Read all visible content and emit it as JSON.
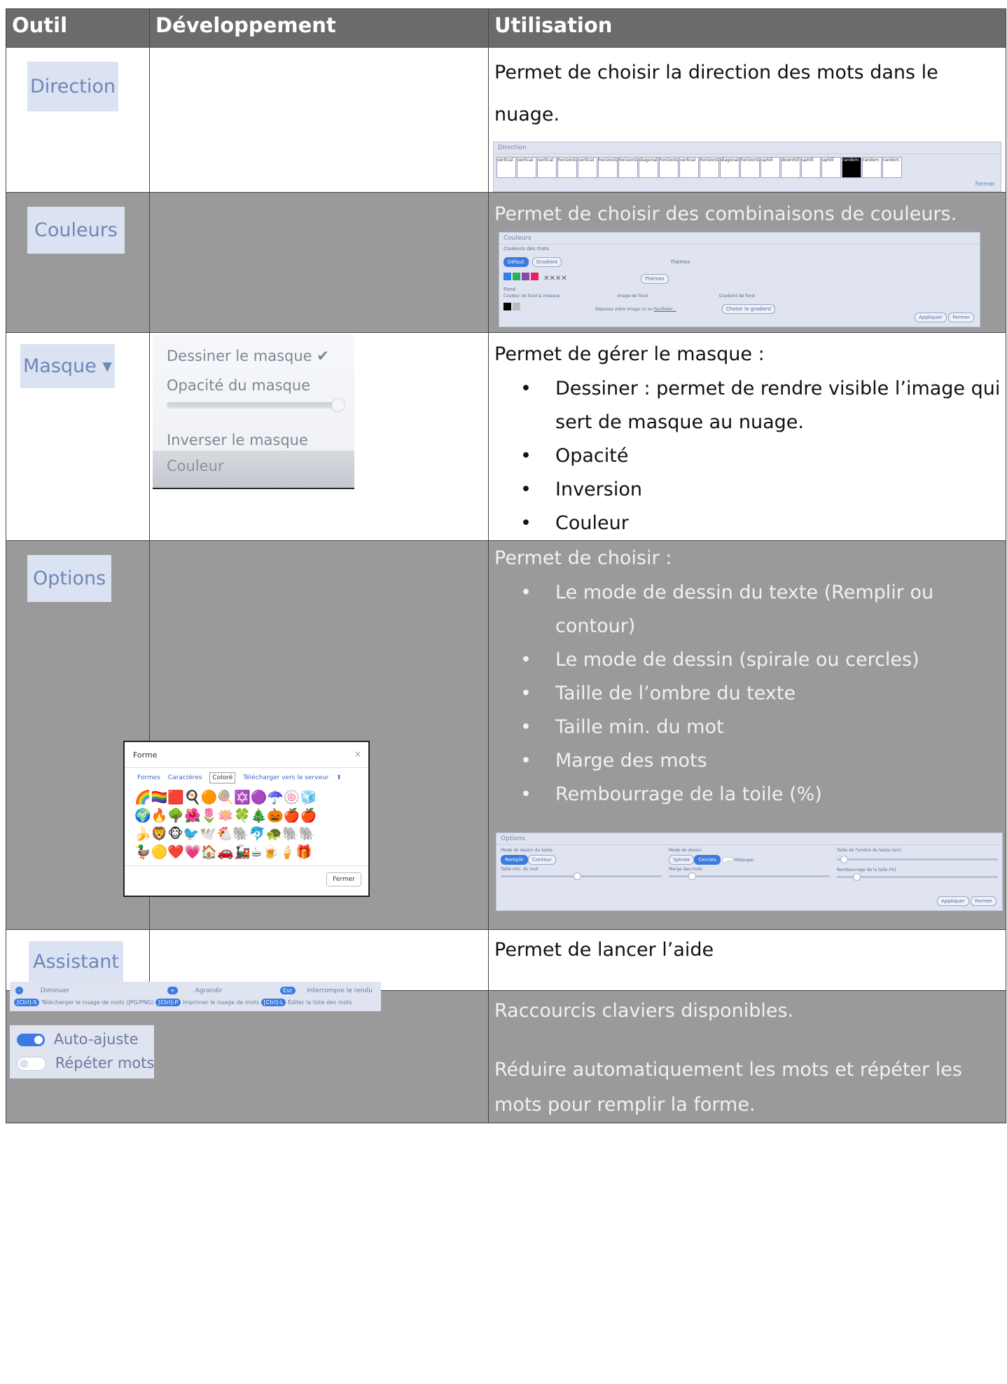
{
  "table": {
    "headers": [
      "Outil",
      "Développement",
      "Utilisation"
    ]
  },
  "rows": {
    "direction": {
      "tool": "Direction",
      "usage": "Permet de choisir la direction des mots dans le nuage.",
      "dialog_title": "Direction",
      "tiles": [
        "vertical",
        "vertical",
        "vertical",
        "horizontal",
        "vertical",
        "horizontal",
        "horizontal",
        "diagonal",
        "horizontal",
        "vertical",
        "horizontal",
        "diagonal",
        "horizontal",
        "uphill",
        "downhill",
        "uphill",
        "uphill",
        "random",
        "random",
        "random"
      ],
      "close": "Fermer"
    },
    "couleurs": {
      "tool": "Couleurs",
      "usage": "Permet de choisir des combinaisons de couleurs.",
      "dialog_title": "Couleurs",
      "section_words": "Couleurs des mots",
      "tab_default": "Défaut",
      "tab_gradient": "Gradient",
      "themes_label": "Thèmes",
      "themes_btn": "Thèmes",
      "section_bg": "Fond",
      "bg_label": "Couleur de fond & masque",
      "bg_image": "Image de fond",
      "bg_drop": "Déposez votre image ici ou",
      "bg_browse": "feuilleter...",
      "gradient_label": "Gradient de fond",
      "gradient_btn": "Choisir le gradient",
      "apply": "Appliquer",
      "close": "Fermer",
      "swatches": [
        "#2f80ed",
        "#27ae60",
        "#8e44ad",
        "#e91e63"
      ]
    },
    "masque": {
      "tool": "Masque ▾",
      "menu_draw": "Dessiner le masque ✔",
      "menu_opacity": "Opacité du masque",
      "menu_invert": "Inverser le masque",
      "menu_color": "Couleur",
      "usage": "Permet de gérer le masque :",
      "items": [
        "Dessiner : permet de rendre visible l’image qui sert de masque au nuage.",
        "Opacité",
        "Inversion",
        "Couleur"
      ]
    },
    "options": {
      "tool": "Options",
      "usage": "Permet de choisir :",
      "items": [
        "Le mode  de dessin du texte (Remplir ou contour)",
        "Le mode de dessin (spirale ou cercles)",
        "Taille de l’ombre du texte",
        "Taille min. du mot",
        "Marge des mots",
        "Rembourrage de la toile (%)"
      ],
      "dialog_title": "Options",
      "opt_text_mode": "Mode de dessin du texte",
      "opt_fill": "Remplir",
      "opt_contour": "Contour",
      "opt_draw_mode": "Mode de dessin",
      "opt_spiral": "Spirale",
      "opt_circles": "Cercles",
      "opt_mix": "Mélanger",
      "opt_shadow": "Taille de l'ombre du texte (em)",
      "opt_min_size": "Taille min. du mot",
      "opt_margin": "Marge des mots",
      "opt_padding": "Rembourrage de la toile (%)",
      "apply": "Appliquer",
      "close": "Fermer",
      "forme": {
        "title": "Forme",
        "close_x": "×",
        "tabs": [
          "Formes",
          "Caractères",
          "Coloré",
          "Télécharger vers le serveur"
        ],
        "emoji_rows": [
          "🌈🏳️‍🌈🟥🍳🟠🍭✡️🟣☂️🍥🧊",
          "🌍🔥🌳🌺🌷🪷🍀🎄🎃🍎🍎",
          "🍌🦁🐵🐦🕊️🐔🐘🐬🐢🐘🐘",
          "🦆🟡❤️💗🏠🚗🚂☕🍺🍦🎁"
        ],
        "close_btn": "Fermer"
      }
    },
    "assistant": {
      "tool": "Assistant",
      "usage": "Permet de lancer l’aide"
    },
    "shortcuts": {
      "usage1": "Raccourcis claviers disponibles.",
      "usage2": "Réduire automatiquement les mots et répéter les mots pour remplir la forme.",
      "keys": [
        {
          "key": "-",
          "label": "Diminuer"
        },
        {
          "key": "+",
          "label": "Agrandir"
        },
        {
          "key": "Esc",
          "label": "Interrompre le rendu"
        },
        {
          "key": "[Ctrl]-S",
          "label": "Télécharger le nuage de mots (JPG/PNG)"
        },
        {
          "key": "[Ctrl]-P",
          "label": "Imprimer le nuage de mots"
        },
        {
          "key": "[Ctrl]-L",
          "label": "Éditer la liste des mots"
        }
      ],
      "toggle_auto": "Auto-ajuste",
      "toggle_repeat": "Répéter mots"
    }
  }
}
